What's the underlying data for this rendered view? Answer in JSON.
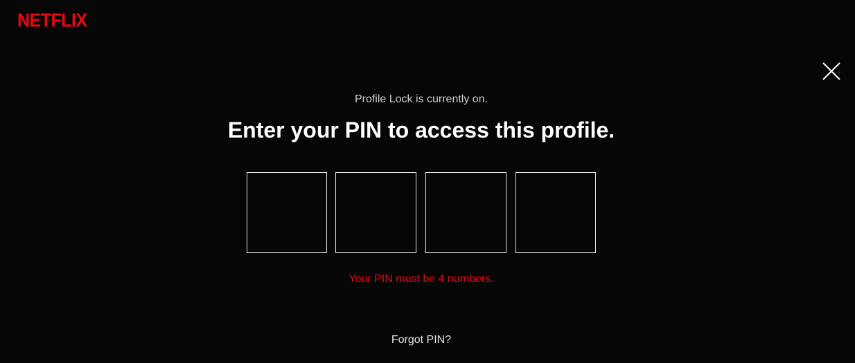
{
  "header": {
    "logo_text": "NETFLIX",
    "brand_color": "#e50914"
  },
  "close": {
    "icon": "close-icon"
  },
  "profile_lock": {
    "status_text": "Profile Lock is currently on.",
    "title": "Enter your PIN to access this profile.",
    "pin_inputs": [
      {
        "value": ""
      },
      {
        "value": ""
      },
      {
        "value": ""
      },
      {
        "value": ""
      }
    ],
    "error_text": "Your PIN must be 4 numbers.",
    "error_color": "#e50914",
    "forgot_link": "Forgot PIN?"
  }
}
